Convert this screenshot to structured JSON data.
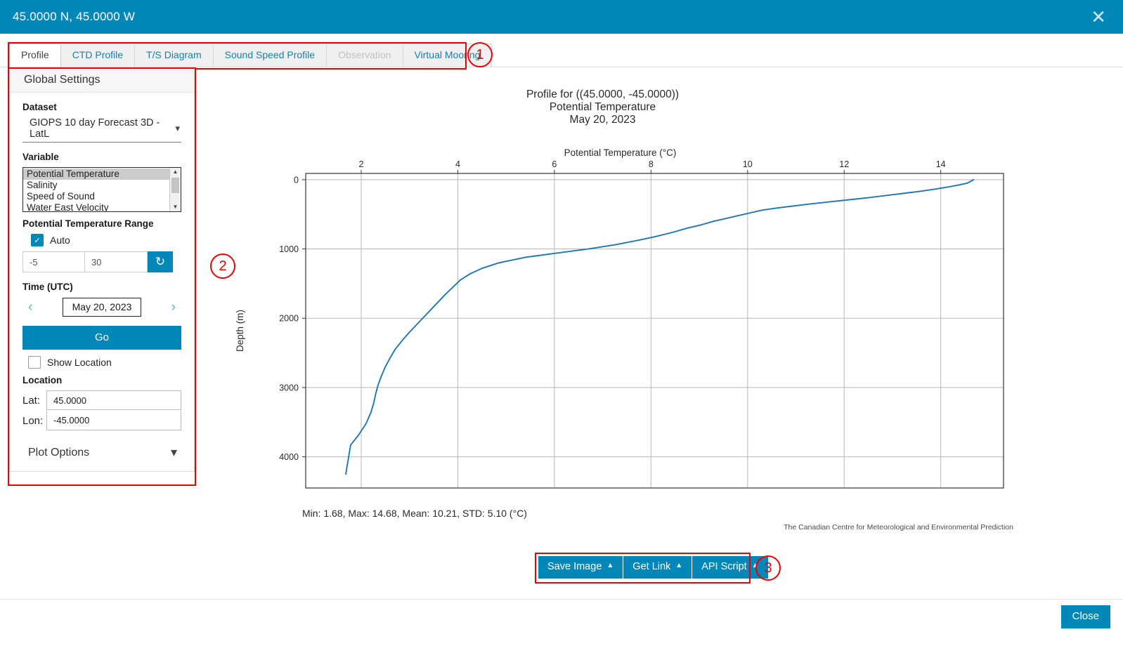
{
  "header": {
    "title": "45.0000 N, 45.0000 W",
    "close_icon": "close-icon"
  },
  "tabs": [
    {
      "label": "Profile",
      "state": "active"
    },
    {
      "label": "CTD Profile",
      "state": "normal"
    },
    {
      "label": "T/S Diagram",
      "state": "normal"
    },
    {
      "label": "Sound Speed Profile",
      "state": "normal"
    },
    {
      "label": "Observation",
      "state": "disabled"
    },
    {
      "label": "Virtual Mooring",
      "state": "normal"
    }
  ],
  "annotations": [
    {
      "number": "1"
    },
    {
      "number": "2"
    },
    {
      "number": "3"
    }
  ],
  "sidebar": {
    "heading": "Global Settings",
    "dataset": {
      "label": "Dataset",
      "value": "GIOPS 10 day Forecast 3D - LatL",
      "chevron": "chevron-down-icon"
    },
    "variable": {
      "label": "Variable",
      "options": [
        "Potential Temperature",
        "Salinity",
        "Speed of Sound",
        "Water East Velocity"
      ],
      "selected": "Potential Temperature",
      "scroll_up_icon": "triangle-up-icon",
      "scroll_down_icon": "triangle-down-icon"
    },
    "range": {
      "label": "Potential Temperature Range",
      "auto_label": "Auto",
      "auto_checked": true,
      "min": "-5",
      "max": "30",
      "reset_icon": "reset-icon"
    },
    "time": {
      "label": "Time (UTC)",
      "prev_icon": "chevron-left-icon",
      "next_icon": "chevron-right-icon",
      "value": "May 20, 2023"
    },
    "go_label": "Go",
    "show_location": {
      "label": "Show Location",
      "checked": false
    },
    "location": {
      "heading": "Location",
      "lat_label": "Lat:",
      "lat_value": "45.0000",
      "lon_label": "Lon:",
      "lon_value": "-45.0000"
    },
    "plot_options": {
      "label": "Plot Options",
      "chevron": "chevron-down-icon"
    }
  },
  "plot": {
    "title_line1": "Profile for ((45.0000, -45.0000))",
    "title_line2": "Potential Temperature",
    "title_line3": "May 20, 2023",
    "stats": "Min: 1.68, Max: 14.68, Mean: 10.21, STD: 5.10 (°C)",
    "attribution": "The Canadian Centre for Meteorological and Environmental Prediction"
  },
  "chart_data": {
    "type": "line",
    "title": "Profile for ((45.0000, -45.0000))\nPotential Temperature\nMay 20, 2023",
    "xlabel": "Potential Temperature (°C)",
    "ylabel": "Depth (m)",
    "xlim": [
      0.85,
      15.3
    ],
    "ylim": [
      4450,
      -90
    ],
    "y_inverted": true,
    "xticks": [
      2,
      4,
      6,
      8,
      10,
      12,
      14
    ],
    "yticks": [
      0,
      1000,
      2000,
      3000,
      4000
    ],
    "xaxis_position": "top",
    "grid": true,
    "legend": null,
    "series": [
      {
        "name": "Potential Temperature",
        "x": [
          14.68,
          14.63,
          14.55,
          14.35,
          14.12,
          13.85,
          13.55,
          13.2,
          12.85,
          12.5,
          12.1,
          11.7,
          11.3,
          10.95,
          10.6,
          10.3,
          10.05,
          9.8,
          9.55,
          9.3,
          9.05,
          8.75,
          8.45,
          8.1,
          7.7,
          7.25,
          6.7,
          6.05,
          5.4,
          4.85,
          4.5,
          4.25,
          4.05,
          3.9,
          3.75,
          3.6,
          3.45,
          3.3,
          3.15,
          3.0,
          2.85,
          2.7,
          2.6,
          2.5,
          2.42,
          2.35,
          2.3,
          2.26,
          2.2,
          2.1,
          1.95,
          1.78,
          1.68
        ],
        "y": [
          0,
          20,
          50,
          80,
          110,
          140,
          170,
          200,
          230,
          260,
          290,
          320,
          350,
          380,
          410,
          440,
          480,
          520,
          560,
          600,
          650,
          700,
          760,
          820,
          880,
          940,
          1000,
          1060,
          1120,
          1200,
          1280,
          1360,
          1450,
          1550,
          1650,
          1760,
          1870,
          1980,
          2090,
          2200,
          2320,
          2450,
          2570,
          2700,
          2830,
          2960,
          3090,
          3220,
          3360,
          3520,
          3680,
          3830,
          4250
        ]
      }
    ],
    "stats": {
      "min": 1.68,
      "max": 14.68,
      "mean": 10.21,
      "std": 5.1,
      "units": "°C"
    },
    "line_color": "#1f77b4"
  },
  "actions": {
    "buttons": [
      {
        "label": "Save Image",
        "caret": "caret-up-icon"
      },
      {
        "label": "Get Link",
        "caret": "caret-up-icon"
      },
      {
        "label": "API Script",
        "caret": "caret-up-icon"
      }
    ]
  },
  "footer": {
    "close_label": "Close"
  },
  "colors": {
    "accent": "#0288b8",
    "annotation": "#ee0000",
    "line": "#1f77b4"
  }
}
